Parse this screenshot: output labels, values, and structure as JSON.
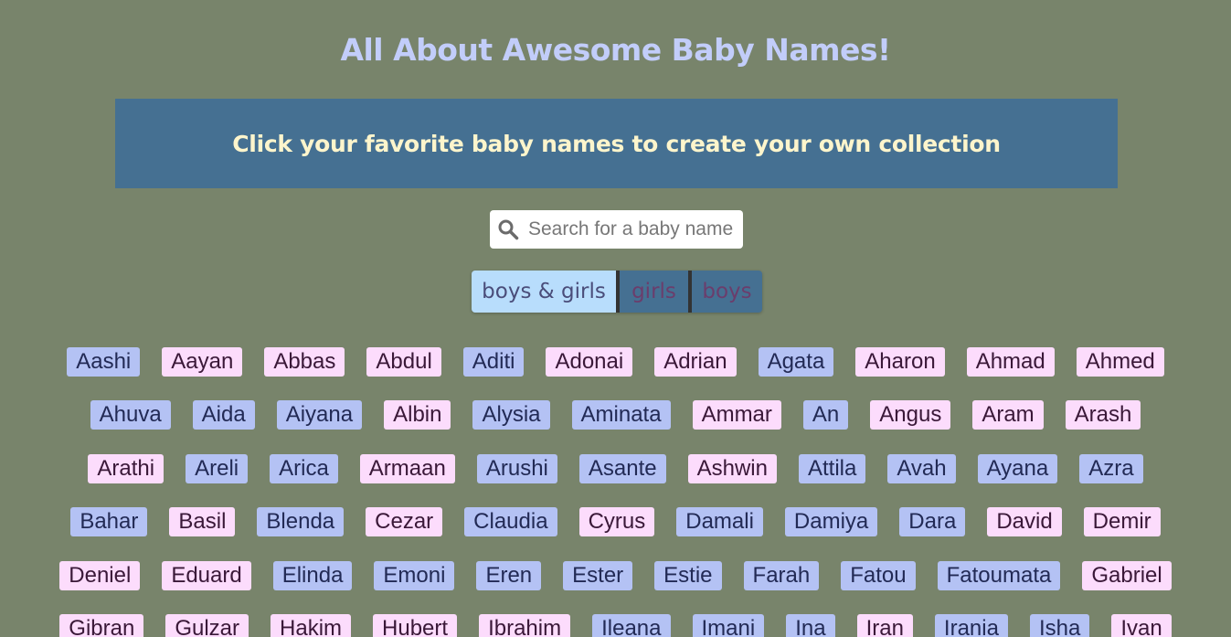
{
  "title": "All About Awesome Baby Names!",
  "banner": {
    "text": "Click your favorite baby names to create your own collection"
  },
  "search": {
    "placeholder": "Search for a baby name",
    "value": ""
  },
  "filters": [
    {
      "label": "boys & girls",
      "active": true
    },
    {
      "label": "girls",
      "active": false
    },
    {
      "label": "boys",
      "active": false
    }
  ],
  "colors": {
    "background": "#78846b",
    "title": "#c2cdfa",
    "banner_bg": "#457092",
    "banner_text": "#fdf5cc",
    "boy_chip": "#b4c2f4",
    "girl_chip": "#fcdcfc"
  },
  "names": [
    [
      {
        "n": "Aashi",
        "s": "boy"
      },
      {
        "n": "Aayan",
        "s": "girl"
      },
      {
        "n": "Abbas",
        "s": "girl"
      },
      {
        "n": "Abdul",
        "s": "girl"
      },
      {
        "n": "Aditi",
        "s": "boy"
      },
      {
        "n": "Adonai",
        "s": "girl"
      },
      {
        "n": "Adrian",
        "s": "girl"
      },
      {
        "n": "Agata",
        "s": "boy"
      },
      {
        "n": "Aharon",
        "s": "girl"
      },
      {
        "n": "Ahmad",
        "s": "girl"
      },
      {
        "n": "Ahmed",
        "s": "girl"
      }
    ],
    [
      {
        "n": "Ahuva",
        "s": "boy"
      },
      {
        "n": "Aida",
        "s": "boy"
      },
      {
        "n": "Aiyana",
        "s": "boy"
      },
      {
        "n": "Albin",
        "s": "girl"
      },
      {
        "n": "Alysia",
        "s": "boy"
      },
      {
        "n": "Aminata",
        "s": "boy"
      },
      {
        "n": "Ammar",
        "s": "girl"
      },
      {
        "n": "An",
        "s": "boy"
      },
      {
        "n": "Angus",
        "s": "girl"
      },
      {
        "n": "Aram",
        "s": "girl"
      },
      {
        "n": "Arash",
        "s": "girl"
      }
    ],
    [
      {
        "n": "Arathi",
        "s": "girl"
      },
      {
        "n": "Areli",
        "s": "boy"
      },
      {
        "n": "Arica",
        "s": "boy"
      },
      {
        "n": "Armaan",
        "s": "girl"
      },
      {
        "n": "Arushi",
        "s": "boy"
      },
      {
        "n": "Asante",
        "s": "boy"
      },
      {
        "n": "Ashwin",
        "s": "girl"
      },
      {
        "n": "Attila",
        "s": "boy"
      },
      {
        "n": "Avah",
        "s": "boy"
      },
      {
        "n": "Ayana",
        "s": "boy"
      },
      {
        "n": "Azra",
        "s": "boy"
      }
    ],
    [
      {
        "n": "Bahar",
        "s": "boy"
      },
      {
        "n": "Basil",
        "s": "girl"
      },
      {
        "n": "Blenda",
        "s": "boy"
      },
      {
        "n": "Cezar",
        "s": "girl"
      },
      {
        "n": "Claudia",
        "s": "boy"
      },
      {
        "n": "Cyrus",
        "s": "girl"
      },
      {
        "n": "Damali",
        "s": "boy"
      },
      {
        "n": "Damiya",
        "s": "boy"
      },
      {
        "n": "Dara",
        "s": "boy"
      },
      {
        "n": "David",
        "s": "girl"
      },
      {
        "n": "Demir",
        "s": "girl"
      }
    ],
    [
      {
        "n": "Deniel",
        "s": "girl"
      },
      {
        "n": "Eduard",
        "s": "girl"
      },
      {
        "n": "Elinda",
        "s": "boy"
      },
      {
        "n": "Emoni",
        "s": "boy"
      },
      {
        "n": "Eren",
        "s": "boy"
      },
      {
        "n": "Ester",
        "s": "boy"
      },
      {
        "n": "Estie",
        "s": "boy"
      },
      {
        "n": "Farah",
        "s": "boy"
      },
      {
        "n": "Fatou",
        "s": "boy"
      },
      {
        "n": "Fatoumata",
        "s": "boy"
      },
      {
        "n": "Gabriel",
        "s": "girl"
      }
    ],
    [
      {
        "n": "Gibran",
        "s": "girl"
      },
      {
        "n": "Gulzar",
        "s": "girl"
      },
      {
        "n": "Hakim",
        "s": "girl"
      },
      {
        "n": "Hubert",
        "s": "girl"
      },
      {
        "n": "Ibrahim",
        "s": "girl"
      },
      {
        "n": "Ileana",
        "s": "boy"
      },
      {
        "n": "Imani",
        "s": "boy"
      },
      {
        "n": "Ina",
        "s": "boy"
      },
      {
        "n": "Iran",
        "s": "girl"
      },
      {
        "n": "Irania",
        "s": "boy"
      },
      {
        "n": "Isha",
        "s": "boy"
      },
      {
        "n": "Ivan",
        "s": "girl"
      }
    ]
  ]
}
